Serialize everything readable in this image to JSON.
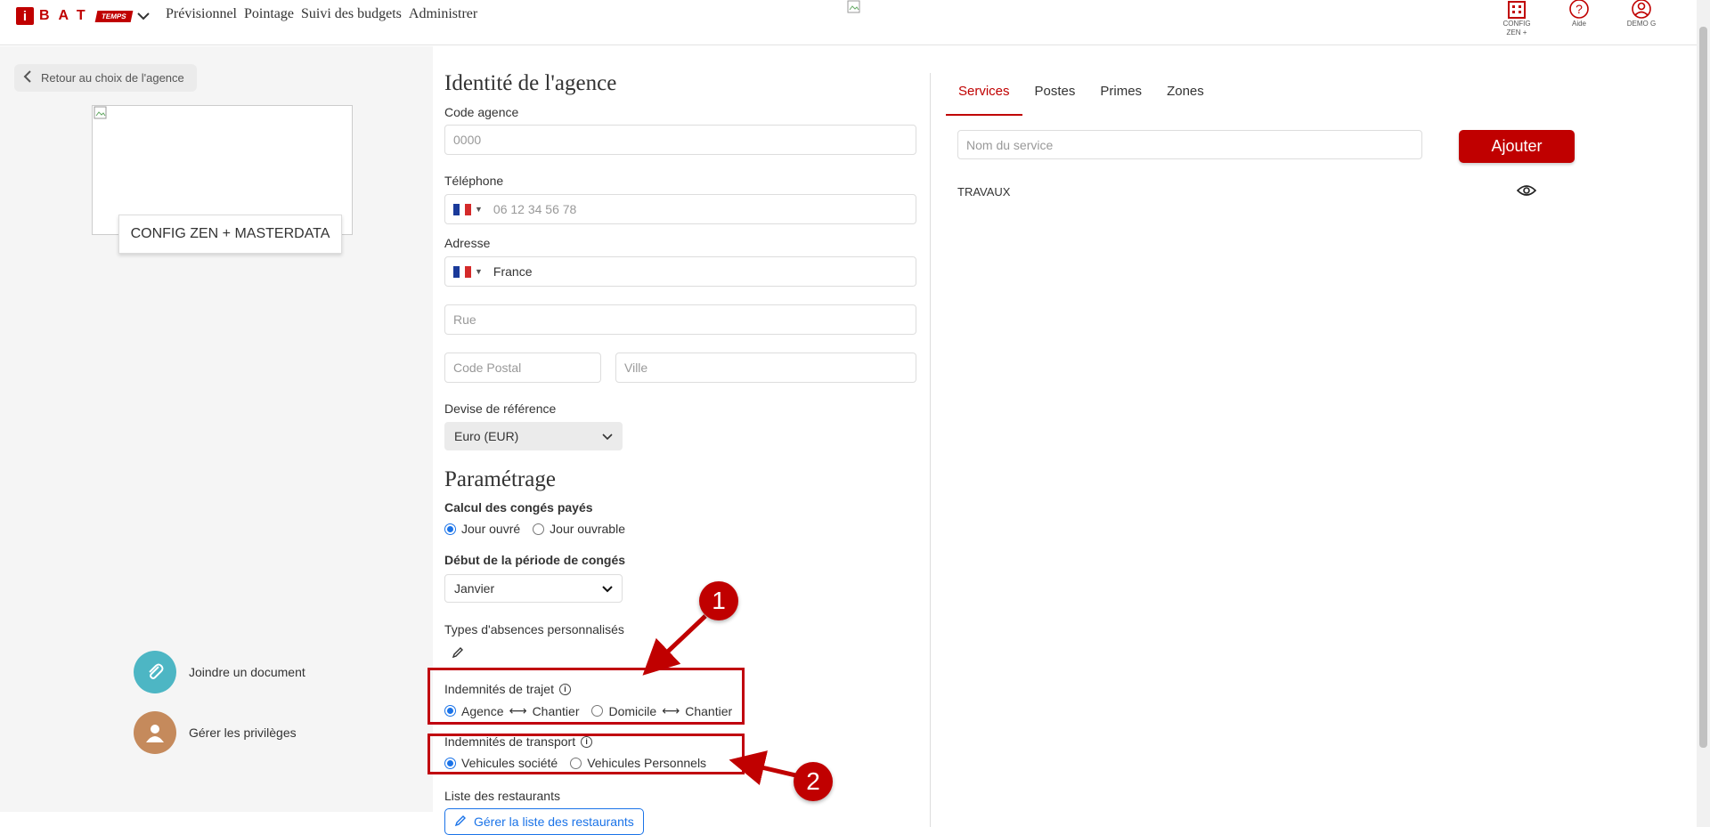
{
  "header": {
    "logo_i": "i",
    "logo_letters": "BAT",
    "logo_tag": "TEMPS",
    "nav": [
      "Prévisionnel",
      "Pointage",
      "Suivi des budgets",
      "Administrer"
    ],
    "icons": [
      {
        "icon": "building-icon",
        "label": "CONFIG ZEN +"
      },
      {
        "icon": "help-icon",
        "label": "Aide"
      },
      {
        "icon": "user-icon",
        "label": "DEMO G"
      }
    ]
  },
  "left": {
    "back_label": "Retour au choix de l'agence",
    "agency_name": "CONFIG ZEN + MASTERDATA",
    "actions": [
      {
        "icon": "paperclip-icon",
        "label": "Joindre un document",
        "color": "#4db6c4"
      },
      {
        "icon": "person-icon",
        "label": "Gérer les privilèges",
        "color": "#c58a5c"
      }
    ]
  },
  "identity": {
    "title": "Identité de l'agence",
    "code_label": "Code agence",
    "code_placeholder": "0000",
    "phone_label": "Téléphone",
    "phone_placeholder": "06 12 34 56 78",
    "address_label": "Adresse",
    "country_value": "France",
    "street_placeholder": "Rue",
    "postal_placeholder": "Code Postal",
    "city_placeholder": "Ville",
    "currency_label": "Devise de référence",
    "currency_value": "Euro (EUR)"
  },
  "settings": {
    "title": "Paramétrage",
    "leave_calc_label": "Calcul des congés payés",
    "leave_calc_options": [
      "Jour ouvré",
      "Jour ouvrable"
    ],
    "leave_start_label": "Début de la période de congés",
    "leave_start_value": "Janvier",
    "absence_types_label": "Types d'absences personnalisés",
    "travel_label": "Indemnités de trajet",
    "travel_opt1_a": "Agence",
    "travel_opt1_b": "Chantier",
    "travel_opt2_a": "Domicile",
    "travel_opt2_b": "Chantier",
    "transport_label": "Indemnités de transport",
    "transport_options": [
      "Vehicules société",
      "Vehicules Personnels"
    ],
    "restaurants_label": "Liste des restaurants",
    "restaurants_button": "Gérer la liste des restaurants"
  },
  "annotations": [
    "1",
    "2"
  ],
  "right": {
    "tabs": [
      "Services",
      "Postes",
      "Primes",
      "Zones"
    ],
    "service_placeholder": "Nom du service",
    "add_button": "Ajouter",
    "services": [
      "TRAVAUX"
    ]
  },
  "colors": {
    "brand": "#c00000",
    "accent": "#1a73e8"
  }
}
